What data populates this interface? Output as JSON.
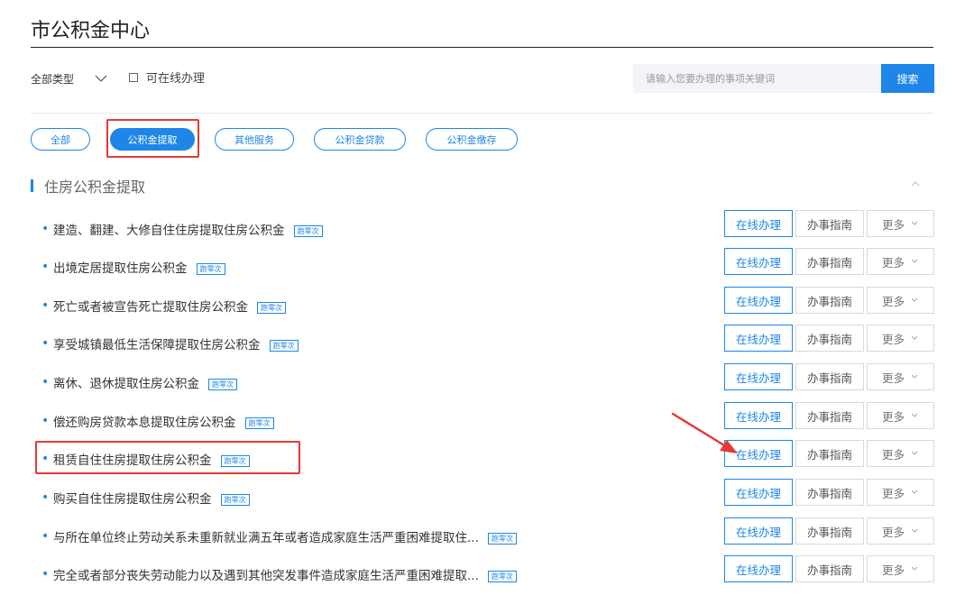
{
  "page": {
    "title": "市公积金中心"
  },
  "filters": {
    "type_label": "全部类型",
    "online_label": "可在线办理"
  },
  "search": {
    "placeholder": "请输入您要办理的事项关键词",
    "button_label": "搜索"
  },
  "categories": [
    {
      "label": "全部",
      "active": false
    },
    {
      "label": "公积金提取",
      "active": true
    },
    {
      "label": "其他服务",
      "active": false
    },
    {
      "label": "公积金贷款",
      "active": false
    },
    {
      "label": "公积金缴存",
      "active": false
    }
  ],
  "section": {
    "title": "住房公积金提取"
  },
  "item_actions": {
    "online": "在线办理",
    "guide": "办事指南",
    "more": "更多"
  },
  "items": [
    {
      "title": "建造、翻建、大修自住住房提取住房公积金",
      "badge": "跑零次"
    },
    {
      "title": "出境定居提取住房公积金",
      "badge": "跑零次"
    },
    {
      "title": "死亡或者被宣告死亡提取住房公积金",
      "badge": "跑零次"
    },
    {
      "title": "享受城镇最低生活保障提取住房公积金",
      "badge": "跑零次"
    },
    {
      "title": "离休、退休提取住房公积金",
      "badge": "跑零次"
    },
    {
      "title": "偿还购房贷款本息提取住房公积金",
      "badge": "跑零次"
    },
    {
      "title": "租赁自住住房提取住房公积金",
      "badge": "跑零次"
    },
    {
      "title": "购买自住住房提取住房公积金",
      "badge": "跑零次"
    },
    {
      "title": "与所在单位终止劳动关系未重新就业满五年或者造成家庭生活严重困难提取住...",
      "badge": "跑零次"
    },
    {
      "title": "完全或者部分丧失劳动能力以及遇到其他突发事件造成家庭生活严重困难提取...",
      "badge": "跑零次"
    }
  ],
  "colors": {
    "accent": "#1e86e8",
    "annotation": "#e53935"
  }
}
